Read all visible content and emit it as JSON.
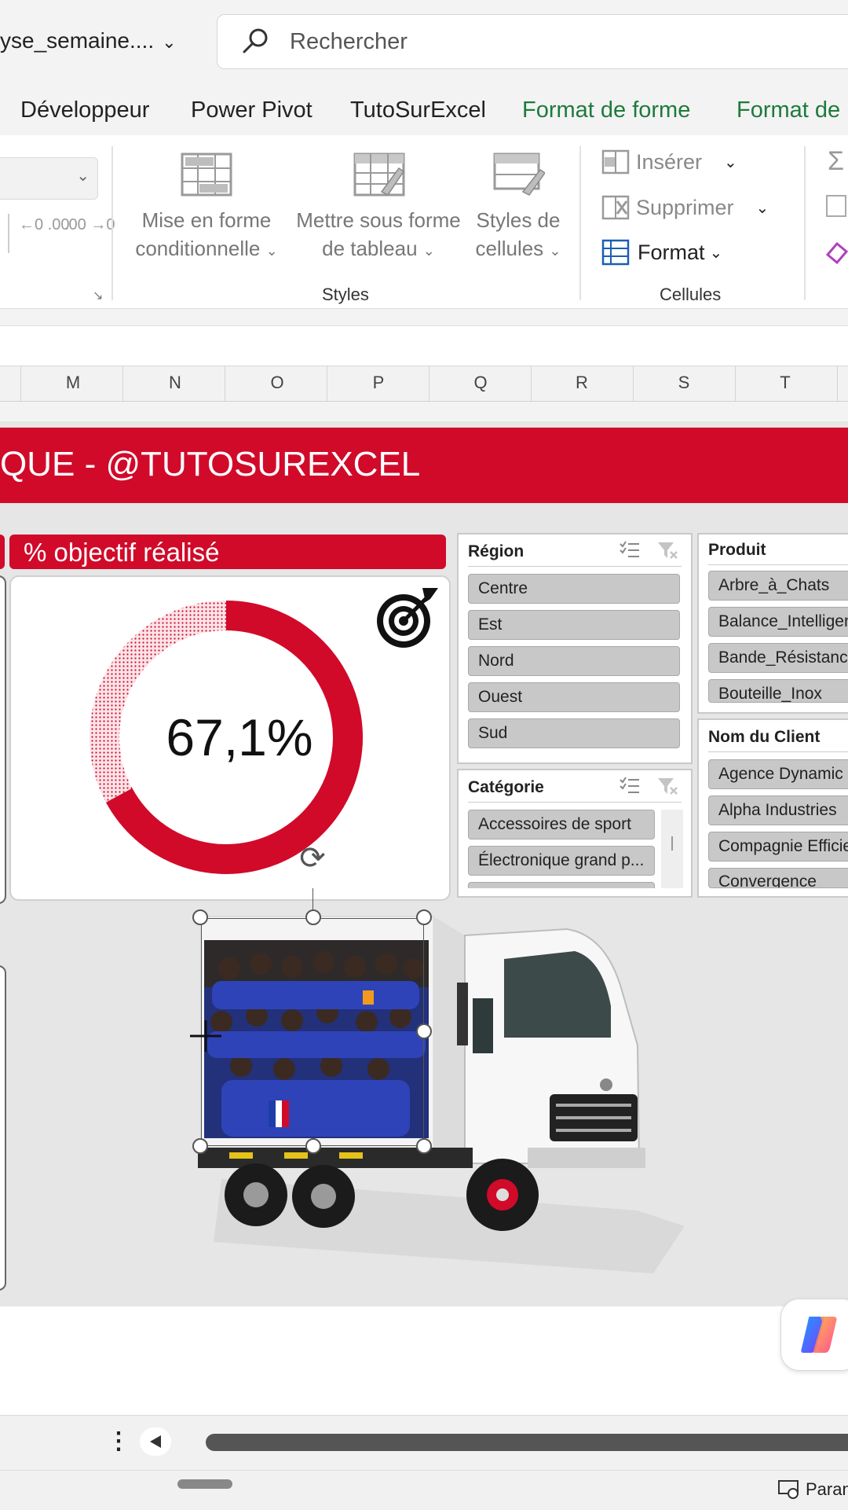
{
  "titlebar": {
    "filename": "yse_semaine....",
    "search_placeholder": "Rechercher"
  },
  "tabs": [
    {
      "label": "Développeur"
    },
    {
      "label": "Power Pivot"
    },
    {
      "label": "TutoSurExcel"
    },
    {
      "label": "Format de forme"
    },
    {
      "label": "Format de"
    }
  ],
  "ribbon": {
    "number_decrease": "←0 .00",
    "number_increase": ".00 →0",
    "conditional_formatting": [
      "Mise en forme",
      "conditionnelle"
    ],
    "format_as_table": [
      "Mettre sous forme",
      "de tableau"
    ],
    "cell_styles": [
      "Styles de",
      "cellules"
    ],
    "styles_group": "Styles",
    "insert": "Insérer",
    "delete": "Supprimer",
    "format": "Format",
    "cells_group": "Cellules"
  },
  "columns": [
    "M",
    "N",
    "O",
    "P",
    "Q",
    "R",
    "S",
    "T"
  ],
  "dashboard": {
    "banner_text": "QUE - @TUTOSUREXCEL",
    "kpi_title": "% objectif réalisé",
    "kpi_value": "67,1%",
    "kpi_fraction": 0.671
  },
  "slicers": {
    "region": {
      "title": "Région",
      "items": [
        "Centre",
        "Est",
        "Nord",
        "Ouest",
        "Sud"
      ]
    },
    "categorie": {
      "title": "Catégorie",
      "items": [
        "Accessoires de sport",
        "Électronique grand p..."
      ]
    },
    "produit": {
      "title": "Produit",
      "items": [
        "Arbre_à_Chats",
        "Balance_Intelligen",
        "Bande_Résistance",
        "Bouteille_Inox"
      ]
    },
    "client": {
      "title": "Nom du Client",
      "items": [
        "Agence Dynamic",
        "Alpha Industries",
        "Compagnie Efficie",
        "Convergence"
      ]
    }
  },
  "status": {
    "settings": "Paran"
  },
  "colors": {
    "accent_red": "#d10a2a",
    "excel_green": "#1e7a3c"
  }
}
